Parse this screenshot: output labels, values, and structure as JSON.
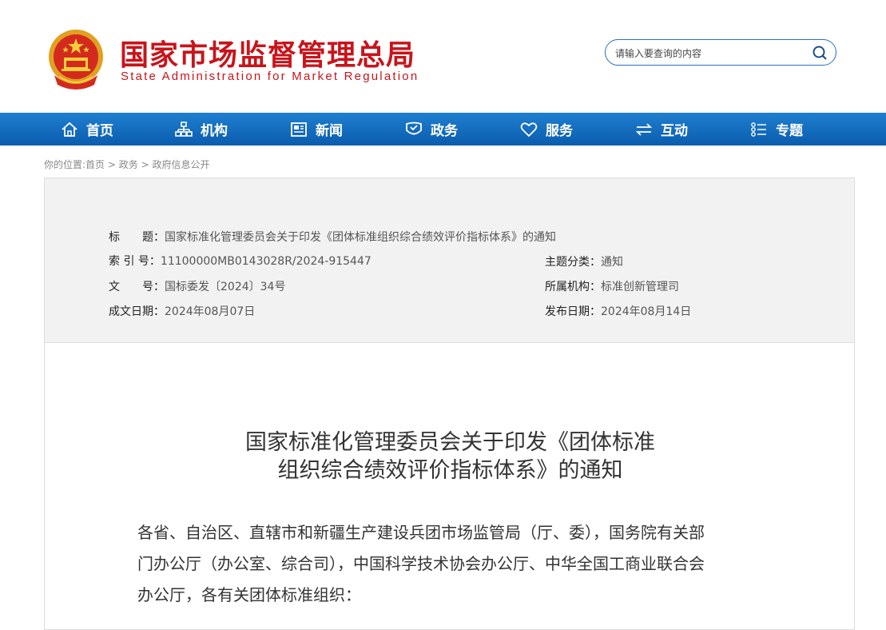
{
  "header": {
    "title_cn": "国家市场监督管理总局",
    "title_en": "State Administration for Market Regulation",
    "search_placeholder": "请输入要查询的内容"
  },
  "nav": {
    "items": [
      {
        "label": "首页",
        "icon": "home-icon"
      },
      {
        "label": "机构",
        "icon": "org-chart-icon"
      },
      {
        "label": "新闻",
        "icon": "news-icon"
      },
      {
        "label": "政务",
        "icon": "shield-book-icon"
      },
      {
        "label": "服务",
        "icon": "heart-icon"
      },
      {
        "label": "互动",
        "icon": "swap-arrows-icon"
      },
      {
        "label": "专题",
        "icon": "topic-list-icon"
      }
    ]
  },
  "breadcrumb": {
    "prefix": "你的位置:",
    "items": [
      "首页",
      "政务",
      "政府信息公开"
    ],
    "separator": ">"
  },
  "meta": {
    "title_label": "标　　题：",
    "title_value": "国家标准化管理委员会关于印发《团体标准组织综合绩效评价指标体系》的通知",
    "index_label": "索 引 号：",
    "index_value": "11100000MB0143028R/2024-915447",
    "category_label": "主题分类：",
    "category_value": "通知",
    "doc_label": "文　　号：",
    "doc_value": "国标委发〔2024〕34号",
    "org_label": "所属机构：",
    "org_value": "标准创新管理司",
    "created_label": "成文日期：",
    "created_value": "2024年08月07日",
    "published_label": "发布日期：",
    "published_value": "2024年08月14日"
  },
  "article": {
    "title_line1": "国家标准化管理委员会关于印发《团体标准",
    "title_line2": "组织综合绩效评价指标体系》的通知",
    "para_line1": "各省、自治区、直辖市和新疆生产建设兵团市场监管局（厅、委），国务院有关部",
    "para_line2": "门办公厅（办公室、综合司），中国科学技术协会办公厅、中华全国工商业联合会",
    "para_line3": "办公厅，各有关团体标准组织："
  },
  "colors": {
    "brand_red": "#c8141b",
    "nav_blue": "#0b5cad",
    "search_border": "#2a6fc0"
  }
}
